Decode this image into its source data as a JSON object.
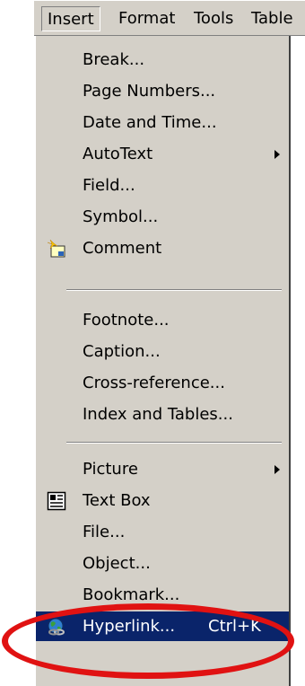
{
  "menubar": {
    "items": [
      {
        "label": "Insert"
      },
      {
        "label": "Format"
      },
      {
        "label": "Tools"
      },
      {
        "label": "Table"
      }
    ]
  },
  "menu": {
    "items": [
      {
        "label": "Break..."
      },
      {
        "label": "Page Numbers..."
      },
      {
        "label": "Date and Time..."
      },
      {
        "label": "AutoText",
        "submenu": true
      },
      {
        "label": "Field..."
      },
      {
        "label": "Symbol..."
      },
      {
        "label": "Comment",
        "icon": "comment-icon"
      },
      {
        "label": "Footnote..."
      },
      {
        "label": "Caption..."
      },
      {
        "label": "Cross-reference..."
      },
      {
        "label": "Index and Tables..."
      },
      {
        "label": "Picture",
        "submenu": true
      },
      {
        "label": "Text Box",
        "icon": "text-box-icon"
      },
      {
        "label": "File..."
      },
      {
        "label": "Object..."
      },
      {
        "label": "Bookmark..."
      },
      {
        "label": "Hyperlink...",
        "shortcut": "Ctrl+K",
        "icon": "hyperlink-globe-icon",
        "highlighted": true
      }
    ]
  },
  "colors": {
    "menu_bg": "#d4d0c8",
    "highlight": "#0a246a",
    "annotation_circle": "#e01212"
  }
}
